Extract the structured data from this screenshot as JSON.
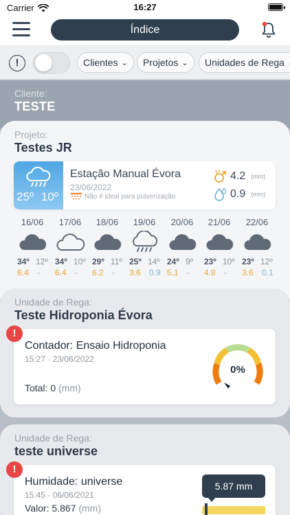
{
  "status_bar": {
    "carrier": "Carrier",
    "time": "16:27"
  },
  "nav": {
    "title": "Índice",
    "menu_icon": "hamburger-menu-icon",
    "bell_icon": "bell-icon"
  },
  "filters": {
    "alert_symbol": "!",
    "alert_filter_on": false,
    "chips": [
      {
        "label": "Clientes"
      },
      {
        "label": "Projetos"
      },
      {
        "label": "Unidades de Rega"
      }
    ]
  },
  "client": {
    "caption": "Cliente:",
    "name": "TESTE"
  },
  "project": {
    "caption": "Projeto:",
    "name": "Testes JR",
    "station": {
      "name": "Estação Manual Évora",
      "date": "23/06/2022",
      "spray_warning": "Não é ideal para pulverização",
      "temp_max": "25º",
      "temp_min": "10º",
      "evapo_value": "4.2",
      "evapo_unit": "(mm)",
      "rain_value": "0.9",
      "rain_unit": "(mm)",
      "colors": {
        "sky_top": "#4fa6e3",
        "evapo": "#e9a73c",
        "rain": "#7fb8d9"
      }
    },
    "forecast": [
      {
        "date": "16/06",
        "icon": "cloud-icon",
        "tmax": "34º",
        "tmin": "12º",
        "evapo": "6.4",
        "rain": "-"
      },
      {
        "date": "17/06",
        "icon": "cloud-outline-icon",
        "tmax": "34º",
        "tmin": "10º",
        "evapo": "6.4",
        "rain": "-"
      },
      {
        "date": "18/06",
        "icon": "cloud-icon",
        "tmax": "29º",
        "tmin": "11º",
        "evapo": "6.2",
        "rain": "-"
      },
      {
        "date": "19/06",
        "icon": "rain-cloud-icon",
        "tmax": "25º",
        "tmin": "14º",
        "evapo": "3.6",
        "rain": "0.9"
      },
      {
        "date": "20/06",
        "icon": "cloud-icon",
        "tmax": "24º",
        "tmin": "9º",
        "evapo": "5.1",
        "rain": "-"
      },
      {
        "date": "21/06",
        "icon": "cloud-icon",
        "tmax": "23º",
        "tmin": "10º",
        "evapo": "4.8",
        "rain": "-"
      },
      {
        "date": "22/06",
        "icon": "cloud-icon",
        "tmax": "23º",
        "tmin": "12º",
        "evapo": "3.6",
        "rain": "0.1"
      }
    ]
  },
  "units": [
    {
      "caption": "Unidade de Rega:",
      "name": "Teste Hidroponia Évora",
      "card": {
        "warning_symbol": "!",
        "title": "Contador: Ensaio Hidroponia",
        "time": "15:27 · 23/06/2022",
        "total_label": "Total: 0",
        "total_unit": "(mm)",
        "gauge_percent": "0%",
        "gauge_fraction": 0
      }
    },
    {
      "caption": "Unidade de Rega:",
      "name": "teste universe",
      "card": {
        "warning_symbol": "!",
        "title": "Humidade: universe",
        "time": "15:45 · 06/06/2021",
        "value_label": "Valor: 5.867",
        "value_unit": "(mm)",
        "bubble_value": "5.87 mm",
        "bar_color": "#f4d65e"
      }
    }
  ]
}
